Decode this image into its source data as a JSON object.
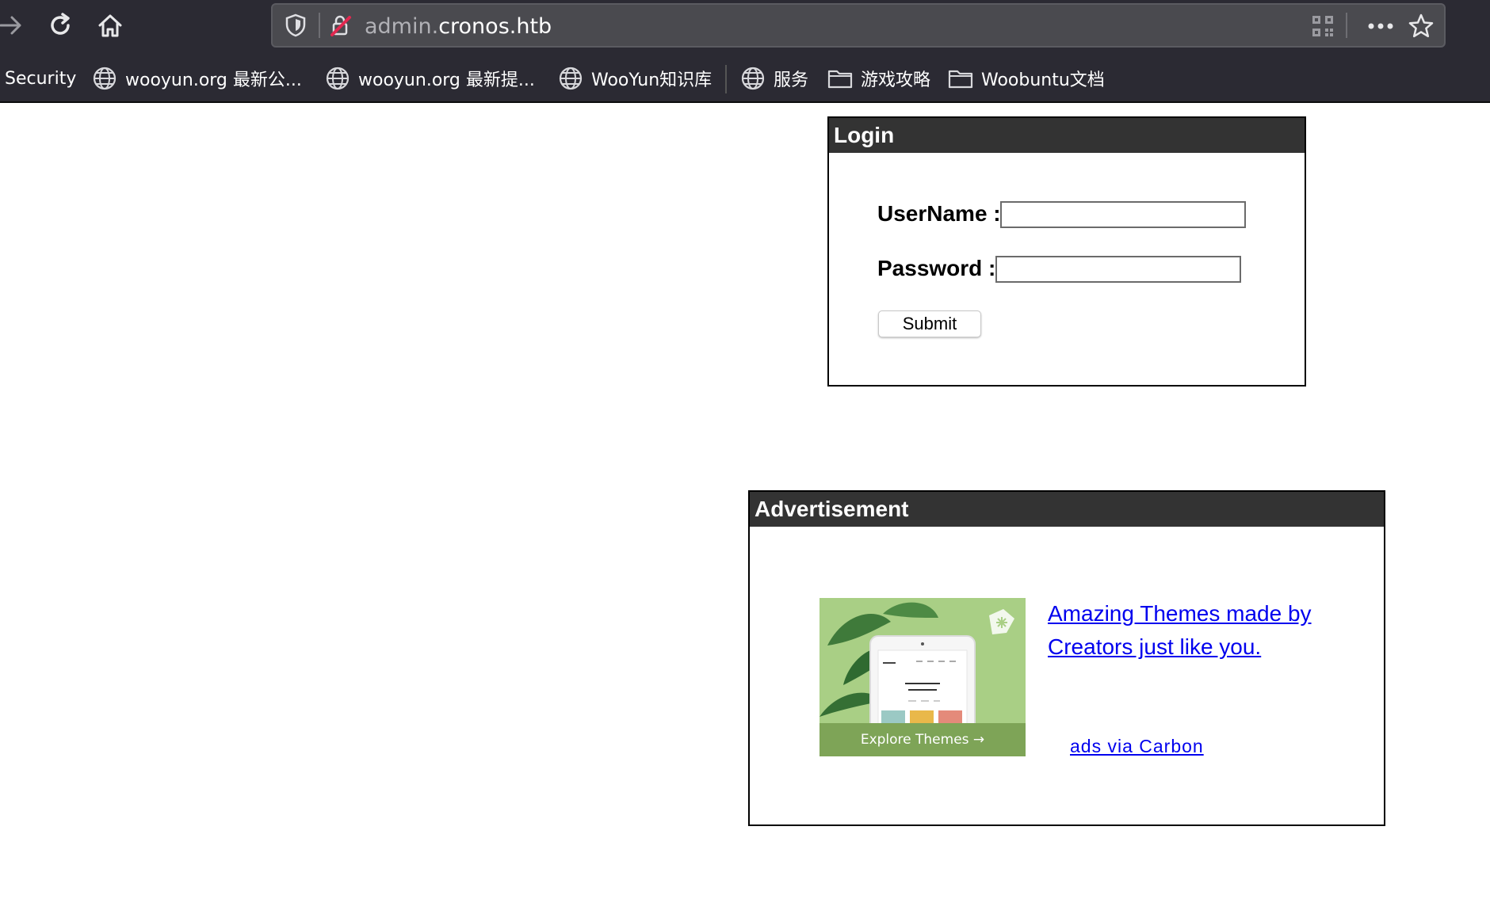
{
  "browser": {
    "url_subdomain": "admin.",
    "url_domain": "cronos.htb",
    "bookmarks": [
      {
        "label": "Security",
        "icon": "none"
      },
      {
        "label": "wooyun.org 最新公...",
        "icon": "globe-icon"
      },
      {
        "label": "wooyun.org 最新提...",
        "icon": "globe-icon"
      },
      {
        "label": "WooYun知识库",
        "icon": "globe-icon"
      },
      {
        "label": "服务",
        "icon": "globe-icon"
      },
      {
        "label": "游戏攻略",
        "icon": "folder-icon"
      },
      {
        "label": "Woobuntu文档",
        "icon": "folder-icon"
      }
    ]
  },
  "login": {
    "title": "Login",
    "username_label": "UserName :",
    "username_value": "",
    "password_label": "Password :",
    "password_value": "",
    "submit_label": "Submit"
  },
  "ad": {
    "title": "Advertisement",
    "image_caption": "Explore Themes →",
    "link_line1": "Amazing Themes made by",
    "link_line2": "Creators just like you.",
    "via_label": "ads via Carbon"
  },
  "colors": {
    "chrome_bg": "#2b2a33",
    "panel_header": "#333333",
    "link": "#0000ee",
    "ad_green": "#a9cf85"
  }
}
